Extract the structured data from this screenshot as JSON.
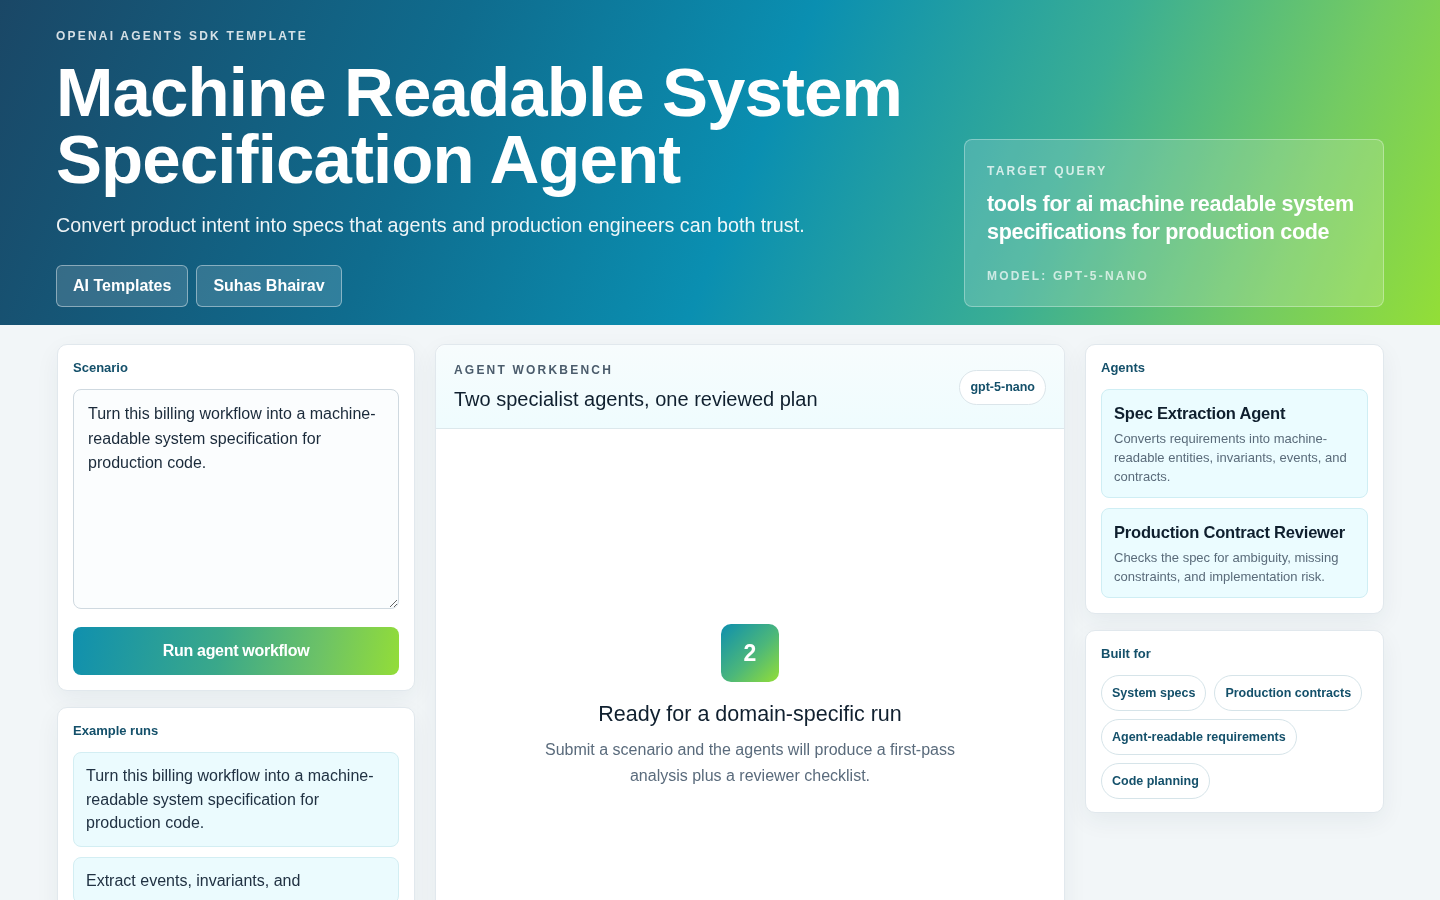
{
  "hero": {
    "eyebrow": "OPENAI AGENTS SDK TEMPLATE",
    "title": "Machine Readable System Specification Agent",
    "subtitle": "Convert product intent into specs that agents and production engineers can both trust.",
    "links": [
      {
        "label": "AI Templates"
      },
      {
        "label": "Suhas Bhairav"
      }
    ]
  },
  "target_query": {
    "eyebrow": "TARGET QUERY",
    "query": "tools for ai machine readable system specifications for production code",
    "model": "MODEL: GPT-5-NANO"
  },
  "scenario": {
    "title": "Scenario",
    "value": "Turn this billing workflow into a machine-readable system specification for production code.",
    "button": "Run agent workflow"
  },
  "examples": {
    "title": "Example runs",
    "items": [
      "Turn this billing workflow into a machine-readable system specification for production code.",
      "Extract events, invariants, and"
    ]
  },
  "workbench": {
    "eyebrow": "AGENT WORKBENCH",
    "title": "Two specialist agents, one reviewed plan",
    "badge": "gpt-5-nano",
    "empty_state": {
      "step": "2",
      "title": "Ready for a domain-specific run",
      "description": "Submit a scenario and the agents will produce a first-pass analysis plus a reviewer checklist."
    }
  },
  "agents": {
    "title": "Agents",
    "items": [
      {
        "name": "Spec Extraction Agent",
        "description": "Converts requirements into machine-readable entities, invariants, events, and contracts."
      },
      {
        "name": "Production Contract Reviewer",
        "description": "Checks the spec for ambiguity, missing constraints, and implementation risk."
      }
    ]
  },
  "built_for": {
    "title": "Built for",
    "tags": [
      "System specs",
      "Production contracts",
      "Agent-readable requirements",
      "Code planning"
    ]
  }
}
